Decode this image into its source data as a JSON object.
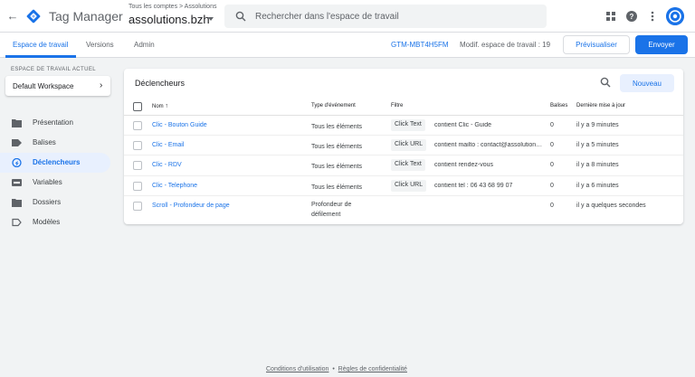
{
  "header": {
    "app_name": "Tag Manager",
    "account_crumb": "Tous les comptes > Assolutions",
    "container_name": "assolutions.bzh",
    "search_placeholder": "Rechercher dans l'espace de travail"
  },
  "tabs": [
    {
      "label": "Espace de travail"
    },
    {
      "label": "Versions"
    },
    {
      "label": "Admin"
    }
  ],
  "toolbar": {
    "container_id": "GTM-MBT4H5FM",
    "workspace_changes": "Modif. espace de travail : 19",
    "preview_label": "Prévisualiser",
    "submit_label": "Envoyer"
  },
  "sidebar": {
    "workspace_label": "ESPACE DE TRAVAIL ACTUEL",
    "workspace_name": "Default Workspace",
    "items": [
      {
        "label": "Présentation",
        "icon": "folder-icon"
      },
      {
        "label": "Balises",
        "icon": "tag-icon"
      },
      {
        "label": "Déclencheurs",
        "icon": "trigger-icon",
        "active": true
      },
      {
        "label": "Variables",
        "icon": "variables-icon"
      },
      {
        "label": "Dossiers",
        "icon": "folder-icon"
      },
      {
        "label": "Modèles",
        "icon": "template-icon"
      }
    ]
  },
  "triggers": {
    "title": "Déclencheurs",
    "new_label": "Nouveau",
    "columns": {
      "name": "Nom",
      "event": "Type d'événement",
      "filter": "Filtre",
      "tags": "Balises",
      "updated": "Dernière mise à jour"
    },
    "rows": [
      {
        "name": "Clic - Bouton Guide",
        "event": "Tous les éléments",
        "filter_var": "Click Text",
        "filter_cond": "contient Clic - Guide",
        "tags": "0",
        "updated": "il y a 9 minutes"
      },
      {
        "name": "Clic - Email",
        "event": "Tous les éléments",
        "filter_var": "Click URL",
        "filter_cond": "contient mailto : contact@assolutions.bzh",
        "tags": "0",
        "updated": "il y a 5 minutes"
      },
      {
        "name": "Clic - RDV",
        "event": "Tous les éléments",
        "filter_var": "Click Text",
        "filter_cond": "contient rendez-vous",
        "tags": "0",
        "updated": "il y a 8 minutes"
      },
      {
        "name": "Clic - Telephone",
        "event": "Tous les éléments",
        "filter_var": "Click URL",
        "filter_cond": "contient tel : 06 43 68 99 07",
        "tags": "0",
        "updated": "il y a 6 minutes"
      },
      {
        "name": "Scroll - Profondeur de page",
        "event": "Profondeur de défilement",
        "filter_var": "",
        "filter_cond": "",
        "tags": "0",
        "updated": "il y a quelques secondes"
      }
    ]
  },
  "footer": {
    "terms": "Conditions d'utilisation",
    "separator": "•",
    "privacy": "Règles de confidentialité"
  },
  "colors": {
    "accent": "#1a73e8",
    "logo_dark": "#1a73e8",
    "logo_light": "#8ab4f8"
  }
}
